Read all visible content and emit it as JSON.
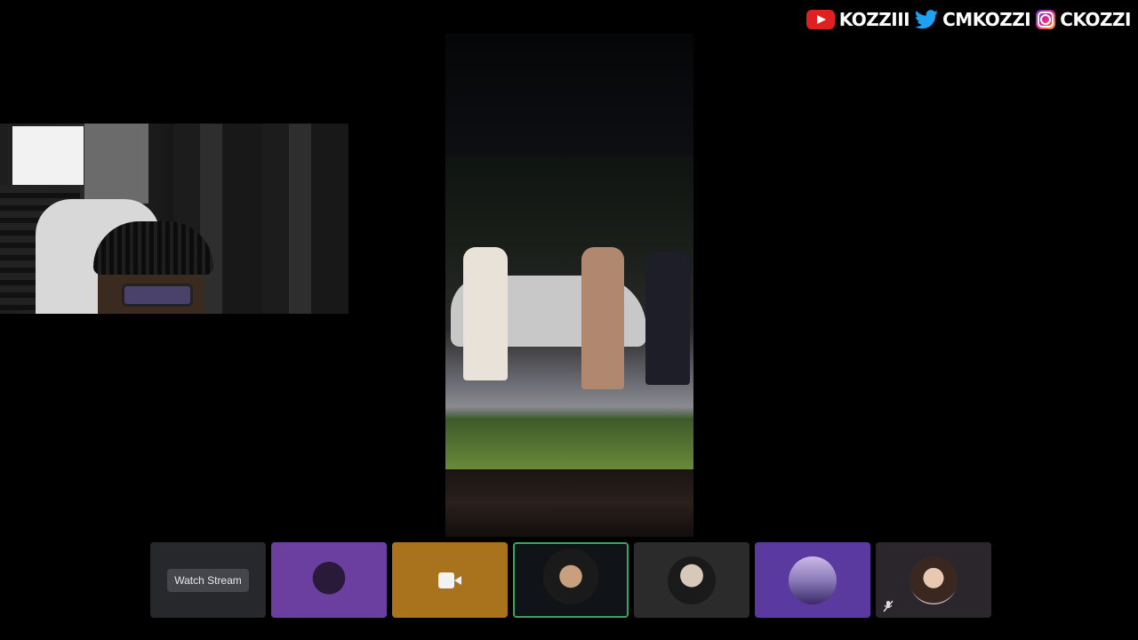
{
  "overlay": {
    "socials": [
      {
        "icon": "youtube-icon",
        "handle": "KOZZIII",
        "color": "#e02020"
      },
      {
        "icon": "twitter-icon",
        "handle": "CMKOZZI",
        "color": "#1da1f2"
      },
      {
        "icon": "instagram-icon",
        "handle": "CKOZZI",
        "color": "#d6249f"
      }
    ]
  },
  "participants": {
    "watch_stream_label": "Watch Stream",
    "active_border_color": "#3ba55c",
    "tiles": [
      {
        "type": "stream-preview"
      },
      {
        "type": "avatar",
        "icon": "creature-avatar"
      },
      {
        "type": "camera",
        "icon": "camera-icon"
      },
      {
        "type": "video",
        "state": "speaking"
      },
      {
        "type": "avatar",
        "icon": "suit-avatar"
      },
      {
        "type": "avatar",
        "icon": "moon-avatar"
      },
      {
        "type": "avatar",
        "icon": "woman-avatar",
        "status": "muted"
      }
    ]
  }
}
